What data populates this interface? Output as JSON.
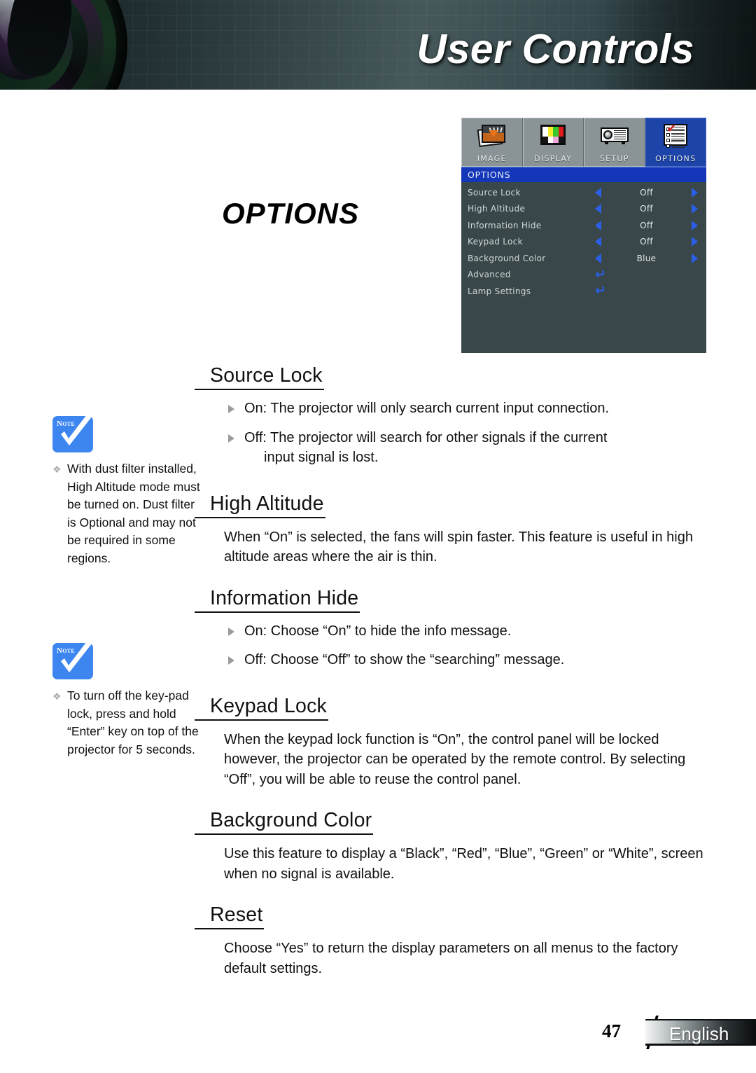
{
  "header": {
    "title": "User Controls",
    "lens_icon": "projector-lens"
  },
  "page_title": "OPTIONS",
  "osd": {
    "tabs": [
      {
        "label": "IMAGE",
        "icon": "image-icon",
        "active": false
      },
      {
        "label": "DISPLAY",
        "icon": "display-icon",
        "active": false
      },
      {
        "label": "SETUP",
        "icon": "setup-icon",
        "active": false
      },
      {
        "label": "OPTIONS",
        "icon": "options-icon",
        "active": true
      }
    ],
    "title": "OPTIONS",
    "rows": [
      {
        "name": "Source Lock",
        "value": "Off",
        "type": "spinner"
      },
      {
        "name": "High Altitude",
        "value": "Off",
        "type": "spinner"
      },
      {
        "name": "Information Hide",
        "value": "Off",
        "type": "spinner"
      },
      {
        "name": "Keypad Lock",
        "value": "Off",
        "type": "spinner"
      },
      {
        "name": "Background Color",
        "value": "Blue",
        "type": "spinner"
      },
      {
        "name": "Advanced",
        "value": "↵",
        "type": "enter"
      },
      {
        "name": "Lamp Settings",
        "value": "↵",
        "type": "enter"
      }
    ],
    "colors": {
      "active_tab": "#1d44a8",
      "title_bar": "#1436b8",
      "arrow": "#2a5fe8",
      "body": "#39474a"
    }
  },
  "notes": [
    {
      "badge": "NOTE",
      "icon": "note-check-icon",
      "text": "With dust filter installed, High Altitude mode must be turned on. Dust filter is Optional and may not be required in some regions."
    },
    {
      "badge": "NOTE",
      "icon": "note-check-icon",
      "text": "To turn off the key-pad lock, press and hold “Enter” key on top of the projector for 5 seconds."
    }
  ],
  "sections": [
    {
      "heading": "Source Lock",
      "bullets": [
        {
          "text": "On: The projector will only search current input connection.",
          "cont": ""
        },
        {
          "text": "Off: The projector will search for other signals if the current",
          "cont": "input signal is lost."
        }
      ],
      "paragraph": ""
    },
    {
      "heading": "High Altitude",
      "bullets": [],
      "paragraph": "When “On” is selected, the fans will spin faster. This feature is useful in high altitude areas where the air is thin."
    },
    {
      "heading": "Information Hide",
      "bullets": [
        {
          "text": "On: Choose “On” to hide the info message.",
          "cont": ""
        },
        {
          "text": "Off: Choose “Off” to show the “searching” message.",
          "cont": ""
        }
      ],
      "paragraph": ""
    },
    {
      "heading": "Keypad Lock",
      "bullets": [],
      "paragraph": "When the keypad lock function is “On”, the control panel will be locked however, the projector can be operated by the remote control. By selecting “Off”, you will be able to reuse the control panel."
    },
    {
      "heading": "Background Color",
      "bullets": [],
      "paragraph": "Use this feature to display a “Black”, “Red”, “Blue”, “Green” or “White”, screen when no signal is available."
    },
    {
      "heading": "Reset",
      "bullets": [],
      "paragraph": "Choose “Yes” to return the display parameters on all menus to the factory default settings."
    }
  ],
  "footer": {
    "page_number": "47",
    "language": "English"
  }
}
